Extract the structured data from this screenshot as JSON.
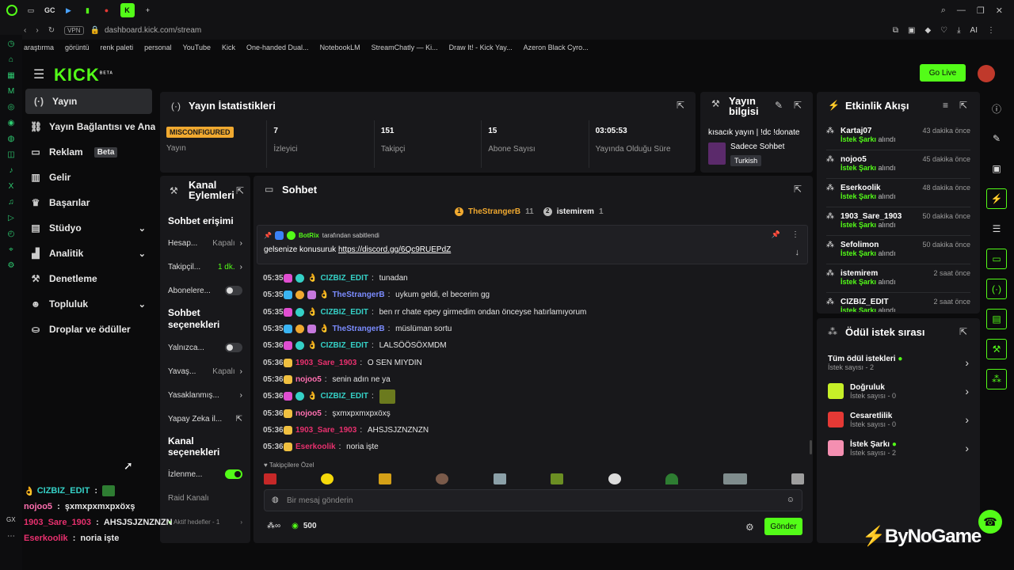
{
  "browser": {
    "tabs": [
      "GC"
    ],
    "url": "dashboard.kick.com/stream",
    "vpn": "VPN",
    "ai": "AI"
  },
  "bookmarks": [
    "araştırma",
    "görüntü",
    "renk paleti",
    "personal",
    "YouTube",
    "Kick",
    "One-handed Dual...",
    "NotebookLM",
    "StreamChatly — Ki...",
    "Draw It! - Kick Yay...",
    "Azeron Black Cyro..."
  ],
  "header": {
    "logo": "KICK",
    "beta": "BETA",
    "go_live": "Go Live"
  },
  "sidebar": {
    "items": [
      {
        "label": "Yayın",
        "icon": "broadcast-icon"
      },
      {
        "label": "Yayın Bağlantısı ve Anahtarı",
        "icon": "link-icon"
      },
      {
        "label": "Reklam",
        "icon": "ad-icon",
        "badge": "Beta"
      },
      {
        "label": "Gelir",
        "icon": "chart-icon"
      },
      {
        "label": "Başarılar",
        "icon": "trophy-icon"
      },
      {
        "label": "Stüdyo",
        "icon": "studio-icon"
      },
      {
        "label": "Analitik",
        "icon": "analytics-icon"
      },
      {
        "label": "Denetleme",
        "icon": "hammer-icon"
      },
      {
        "label": "Topluluk",
        "icon": "community-icon"
      },
      {
        "label": "Droplar ve ödüller",
        "icon": "drops-icon"
      }
    ]
  },
  "stats": {
    "title": "Yayın İstatistikleri",
    "status_badge": "MISCONFIGURED",
    "items": [
      {
        "value": "",
        "label": "Yayın"
      },
      {
        "value": "7",
        "label": "İzleyici"
      },
      {
        "value": "151",
        "label": "Takipçi"
      },
      {
        "value": "15",
        "label": "Abone Sayısı"
      },
      {
        "value": "03:05:53",
        "label": "Yayında Olduğu Süre"
      }
    ]
  },
  "stream_info": {
    "title": "Yayın bilgisi",
    "stream_title": "kısacık yayın | !dc !donate",
    "category": "Sadece Sohbet",
    "language": "Turkish"
  },
  "activity": {
    "title": "Etkinlik Akışı",
    "action": "İstek Şarkı",
    "suffix": "alındı",
    "events": [
      {
        "user": "Kartaj07",
        "time": "43 dakika önce"
      },
      {
        "user": "nojoo5",
        "time": "45 dakika önce"
      },
      {
        "user": "Eserkoolik",
        "time": "48 dakika önce"
      },
      {
        "user": "1903_Sare_1903",
        "time": "50 dakika önce"
      },
      {
        "user": "Sefolimon",
        "time": "50 dakika önce"
      },
      {
        "user": "istemirem",
        "time": "2 saat önce"
      },
      {
        "user": "CIZBIZ_EDIT",
        "time": "2 saat önce"
      }
    ]
  },
  "rewards": {
    "title": "Ödül istek sırası",
    "all": "Tüm ödül istekleri",
    "all_count": "İstek sayısı - 2",
    "items": [
      {
        "name": "Doğruluk",
        "count": "İstek sayısı - 0",
        "color": "#c6f028"
      },
      {
        "name": "Cesaretlilik",
        "count": "İstek sayısı - 0",
        "color": "#e53935"
      },
      {
        "name": "İstek Şarkı",
        "count": "İstek sayısı - 2",
        "color": "#f48fb1"
      }
    ]
  },
  "channel_actions": {
    "title": "Kanal Eylemleri",
    "sections": [
      {
        "title": "Sohbet erişimi",
        "rows": [
          {
            "label": "Hesap...",
            "value": "Kapalı",
            "type": "chevron"
          },
          {
            "label": "Takipçil...",
            "value": "1 dk.",
            "type": "chevron",
            "green": true
          },
          {
            "label": "Abonelere...",
            "type": "toggle"
          }
        ]
      },
      {
        "title": "Sohbet seçenekleri",
        "rows": [
          {
            "label": "Yalnızca...",
            "type": "toggle"
          },
          {
            "label": "Yavaş...",
            "value": "Kapalı",
            "type": "chevron"
          },
          {
            "label": "Yasaklanmış...",
            "type": "chevron"
          },
          {
            "label": "Yapay Zeka il...",
            "type": "external"
          }
        ]
      },
      {
        "title": "Kanal seçenekleri",
        "rows": [
          {
            "label": "İzlenme...",
            "type": "toggle",
            "on": true
          },
          {
            "label": "Raid Kanalı",
            "type": "none"
          }
        ]
      }
    ],
    "footer": "Aktif hedefler - 1"
  },
  "chat": {
    "title": "Sohbet",
    "top_users": [
      {
        "rank": "1",
        "name": "TheStrangerB",
        "count": "11"
      },
      {
        "rank": "2",
        "name": "istemirem",
        "count": "1"
      }
    ],
    "pinned_by": "BotRix",
    "pinned_by_suffix": "tarafından sabitlendi",
    "pinned_text": "gelsenize konusuruk",
    "pinned_link": "https://discord.gg/6Qc9RUEPdZ",
    "messages": [
      {
        "time": "05:35",
        "user": "CIZBIZ_EDIT",
        "color": "#35d0c6",
        "text": "tunadan"
      },
      {
        "time": "05:35",
        "user": "TheStrangerB",
        "color": "#7b8cff",
        "text": "uykum geldi, el becerim gg"
      },
      {
        "time": "05:35",
        "user": "CIZBIZ_EDIT",
        "color": "#35d0c6",
        "text": "ben rr chate epey girmedim ondan önceyse hatırlamıyorum"
      },
      {
        "time": "05:35",
        "user": "TheStrangerB",
        "color": "#7b8cff",
        "text": "müslüman sortu"
      },
      {
        "time": "05:36",
        "user": "CIZBIZ_EDIT",
        "color": "#35d0c6",
        "text": "LALSÖÖSÖXMDM"
      },
      {
        "time": "05:36",
        "user": "1903_Sare_1903",
        "color": "#e8306e",
        "text": "O SEN MIYDIN"
      },
      {
        "time": "05:36",
        "user": "nojoo5",
        "color": "#ff6fb0",
        "text": "senin adın ne ya"
      },
      {
        "time": "05:36",
        "user": "CIZBIZ_EDIT",
        "color": "#35d0c6",
        "text": ""
      },
      {
        "time": "05:36",
        "user": "nojoo5",
        "color": "#ff6fb0",
        "text": "şxmxpxmxpxöxş"
      },
      {
        "time": "05:36",
        "user": "1903_Sare_1903",
        "color": "#e8306e",
        "text": "AHSJSJZNZNZN"
      },
      {
        "time": "05:36",
        "user": "Eserkoolik",
        "color": "#e8306e",
        "text": "noria işte"
      }
    ],
    "followers_only": "Takipçilere Özel",
    "input_placeholder": "Bir mesaj gönderin",
    "points": "500",
    "send": "Gönder"
  },
  "overlay": [
    {
      "user": "CIZBIZ_EDIT",
      "color": "#35d0c6",
      "text": ""
    },
    {
      "user": "nojoo5",
      "color": "#ff6fb0",
      "text": "şxmxpxmxpxöxş"
    },
    {
      "user": "1903_Sare_1903",
      "color": "#e8306e",
      "text": "AHSJSJZNZNZN"
    },
    {
      "user": "Eserkoolik",
      "color": "#e8306e",
      "text": "noria işte"
    }
  ],
  "watermark": "ByNoGame"
}
